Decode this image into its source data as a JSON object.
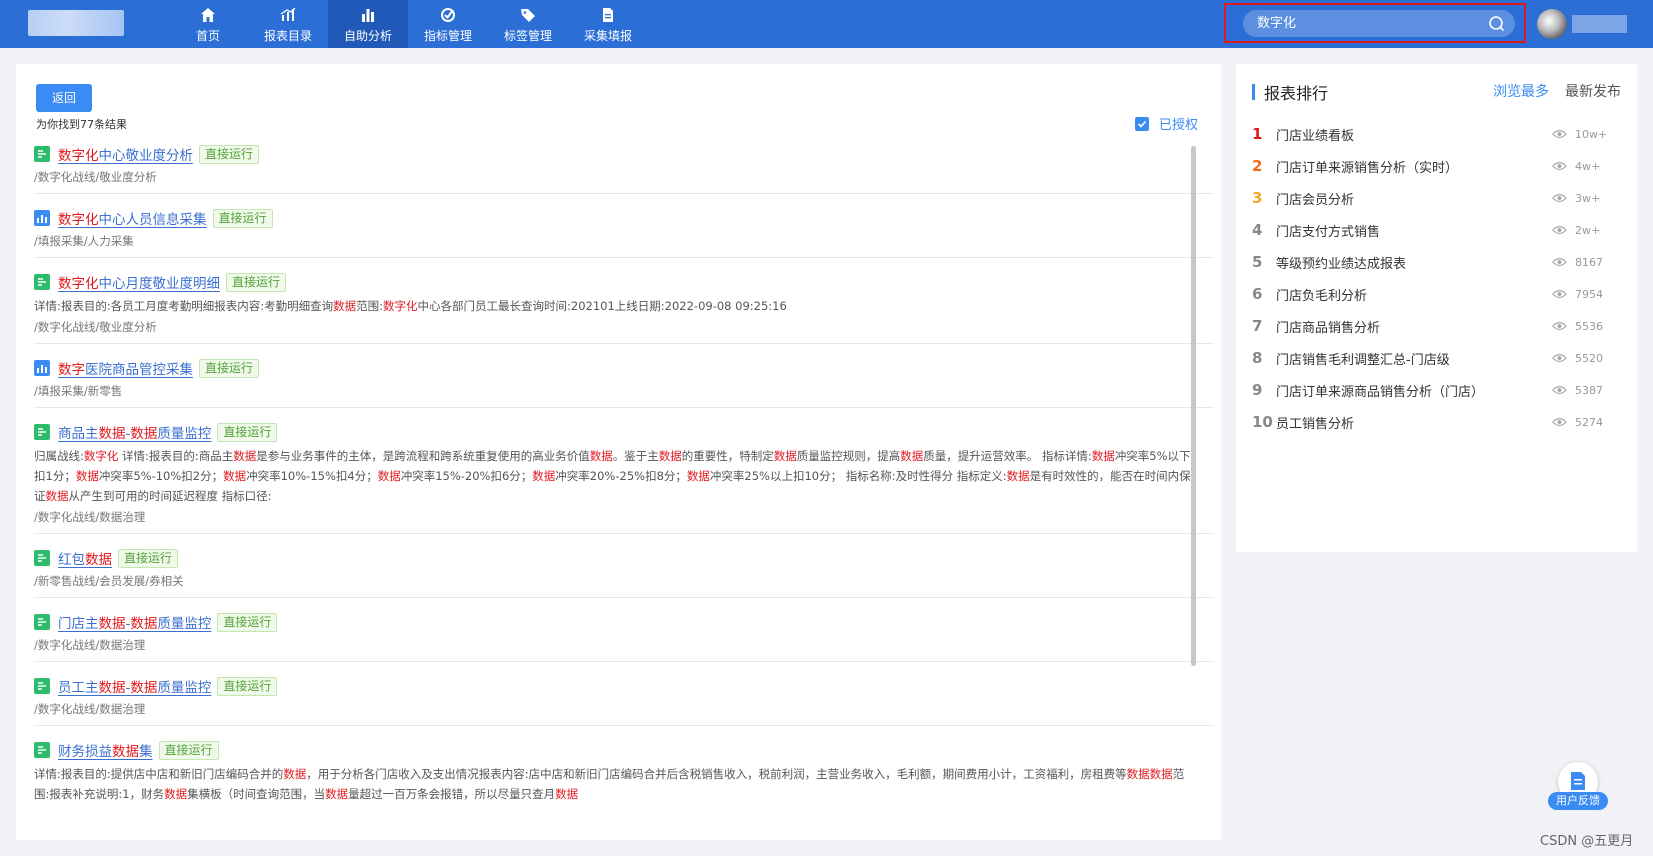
{
  "header": {
    "nav": [
      {
        "label": "首页",
        "icon": "home-icon"
      },
      {
        "label": "报表目录",
        "icon": "report-catalog-icon"
      },
      {
        "label": "自助分析",
        "icon": "bar-chart-icon",
        "active": true
      },
      {
        "label": "指标管理",
        "icon": "target-icon"
      },
      {
        "label": "标签管理",
        "icon": "tag-icon"
      },
      {
        "label": "采集填报",
        "icon": "form-icon"
      }
    ],
    "search_value": "数字化"
  },
  "main": {
    "back_label": "返回",
    "found_text": "为你找到77条结果",
    "authorized_label": "已授权",
    "results": [
      {
        "icon": "green",
        "title_hl": "数字化",
        "title_rest": "中心敬业度分析",
        "tag": "直接运行",
        "desc": "",
        "path": "/数字化战线/敬业度分析"
      },
      {
        "icon": "blue",
        "title_hl": "数字化",
        "title_rest": "中心人员信息采集",
        "tag": "直接运行",
        "desc": "",
        "path": "/填报采集/人力采集"
      },
      {
        "icon": "green",
        "title_hl": "数字化",
        "title_rest": "中心月度敬业度明细",
        "tag": "直接运行",
        "desc": "详情:报表目的:各员工月度考勤明细报表内容:考勤明细查询数据范围:数字化中心各部门员工最长查询时间:202101上线日期:2022-09-08 09:25:16",
        "path": "/数字化战线/敬业度分析"
      },
      {
        "icon": "blue",
        "title_hl": "数字",
        "title_rest": "医院商品管控采集",
        "tag": "直接运行",
        "desc": "",
        "path": "/填报采集/新零售"
      },
      {
        "icon": "green",
        "title_hl": "",
        "title_rest": "商品主数据-数据质量监控",
        "tag": "直接运行",
        "desc": "归属战线:数字化 详情:报表目的:商品主数据是参与业务事件的主体，是跨流程和跨系统重复使用的高业务价值数据。鉴于主数据的重要性，特制定数据质量监控规则，提高数据质量，提升运营效率。 指标详情:数据冲突率5%以下扣1分；数据冲突率5%-10%扣2分；数据冲突率10%-15%扣4分；数据冲突率15%-20%扣6分；数据冲突率20%-25%扣8分；数据冲突率25%以上扣10分； 指标名称:及时性得分 指标定义:数据是有时效性的，能否在时间内保证数据从产生到可用的时间延迟程度 指标口径:",
        "path": "/数字化战线/数据治理"
      },
      {
        "icon": "green",
        "title_hl": "",
        "title_rest": "红包数据",
        "tag": "直接运行",
        "desc": "",
        "path": "/新零售战线/会员发展/券相关"
      },
      {
        "icon": "green",
        "title_hl": "",
        "title_rest": "门店主数据-数据质量监控",
        "tag": "直接运行",
        "desc": "",
        "path": "/数字化战线/数据治理"
      },
      {
        "icon": "green",
        "title_hl": "",
        "title_rest": "员工主数据-数据质量监控",
        "tag": "直接运行",
        "desc": "",
        "path": "/数字化战线/数据治理"
      },
      {
        "icon": "green",
        "title_hl": "",
        "title_rest": "财务损益数据集",
        "tag": "直接运行",
        "desc": "详情:报表目的:提供店中店和新旧门店编码合并的数据，用于分析各门店收入及支出情况报表内容:店中店和新旧门店编码合并后含税销售收入，税前利润，主营业务收入，毛利额，期间费用小计，工资福利，房租费等数据数据范围:报表补充说明:1，财务数据集横板（时间查询范围，当数据量超过一百万条会报错，所以尽量只查月数据",
        "path": ""
      }
    ]
  },
  "side": {
    "title": "报表排行",
    "tabs": [
      "浏览最多",
      "最新发布"
    ],
    "ranks": [
      {
        "num": "1",
        "name": "门店业绩看板",
        "views": "10w+",
        "color": "#e0191f"
      },
      {
        "num": "2",
        "name": "门店订单来源销售分析（实时）",
        "views": "4w+",
        "color": "#f06a1c"
      },
      {
        "num": "3",
        "name": "门店会员分析",
        "views": "3w+",
        "color": "#f5a623"
      },
      {
        "num": "4",
        "name": "门店支付方式销售",
        "views": "2w+",
        "color": "#888888"
      },
      {
        "num": "5",
        "name": "等级预约业绩达成报表",
        "views": "8167",
        "color": "#888888"
      },
      {
        "num": "6",
        "name": "门店负毛利分析",
        "views": "7954",
        "color": "#888888"
      },
      {
        "num": "7",
        "name": "门店商品销售分析",
        "views": "5536",
        "color": "#888888"
      },
      {
        "num": "8",
        "name": "门店销售毛利调整汇总-门店级",
        "views": "5520",
        "color": "#888888"
      },
      {
        "num": "9",
        "name": "门店订单来源商品销售分析（门店）",
        "views": "5387",
        "color": "#888888"
      },
      {
        "num": "10",
        "name": "员工销售分析",
        "views": "5274",
        "color": "#888888"
      }
    ]
  },
  "feedback_label": "用户反馈",
  "watermark_text": "CSDN @五更月"
}
